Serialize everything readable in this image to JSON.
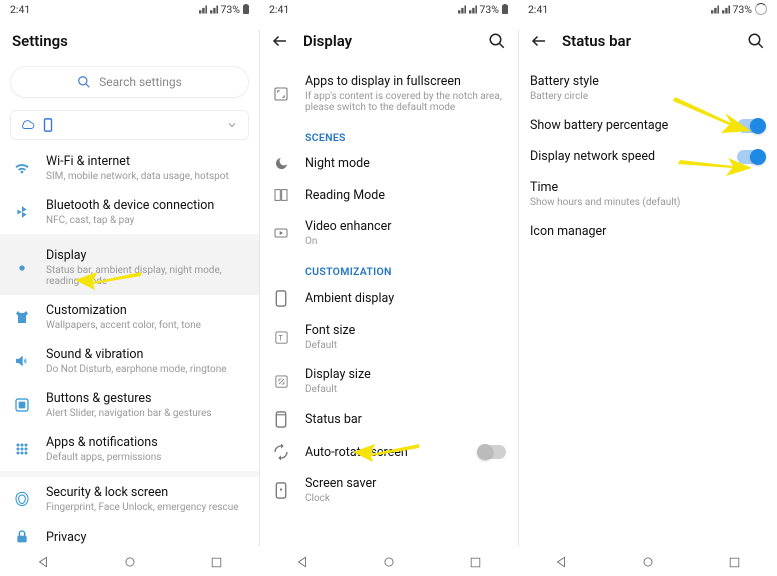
{
  "sys": {
    "time": "2:41",
    "battery": "73%"
  },
  "p1": {
    "title": "Settings",
    "search_placeholder": "Search settings",
    "items": [
      {
        "title": "Wi-Fi & internet",
        "sub": "SIM, mobile network, data usage, hotspot"
      },
      {
        "title": "Bluetooth & device connection",
        "sub": "NFC, cast, tap & pay"
      },
      {
        "title": "Display",
        "sub": "Status bar, ambient display, night mode, reading mode"
      },
      {
        "title": "Customization",
        "sub": "Wallpapers, accent color, font, tone"
      },
      {
        "title": "Sound & vibration",
        "sub": "Do Not Disturb, earphone mode, ringtone"
      },
      {
        "title": "Buttons & gestures",
        "sub": "Alert Slider, navigation bar & gestures"
      },
      {
        "title": "Apps & notifications",
        "sub": "Default apps, permissions"
      },
      {
        "title": "Security & lock screen",
        "sub": "Fingerprint, Face Unlock, emergency rescue"
      },
      {
        "title": "Privacy",
        "sub": ""
      }
    ]
  },
  "p2": {
    "title": "Display",
    "top": {
      "title": "Apps to display in fullscreen",
      "sub": "If app's content is covered by the notch area, please switch to the default mode"
    },
    "sect1": "SCENES",
    "scenes": [
      {
        "title": "Night mode",
        "sub": ""
      },
      {
        "title": "Reading Mode",
        "sub": ""
      },
      {
        "title": "Video enhancer",
        "sub": "On"
      }
    ],
    "sect2": "CUSTOMIZATION",
    "custom": [
      {
        "title": "Ambient display",
        "sub": ""
      },
      {
        "title": "Font size",
        "sub": "Default"
      },
      {
        "title": "Display size",
        "sub": "Default"
      },
      {
        "title": "Status bar",
        "sub": ""
      },
      {
        "title": "Auto-rotate screen",
        "sub": ""
      },
      {
        "title": "Screen saver",
        "sub": "Clock"
      }
    ]
  },
  "p3": {
    "title": "Status bar",
    "items": [
      {
        "title": "Battery style",
        "sub": "Battery circle"
      },
      {
        "title": "Show battery percentage",
        "sub": "",
        "toggle": true
      },
      {
        "title": "Display network speed",
        "sub": "",
        "toggle": true
      },
      {
        "title": "Time",
        "sub": "Show hours and minutes (default)"
      },
      {
        "title": "Icon manager",
        "sub": ""
      }
    ]
  }
}
